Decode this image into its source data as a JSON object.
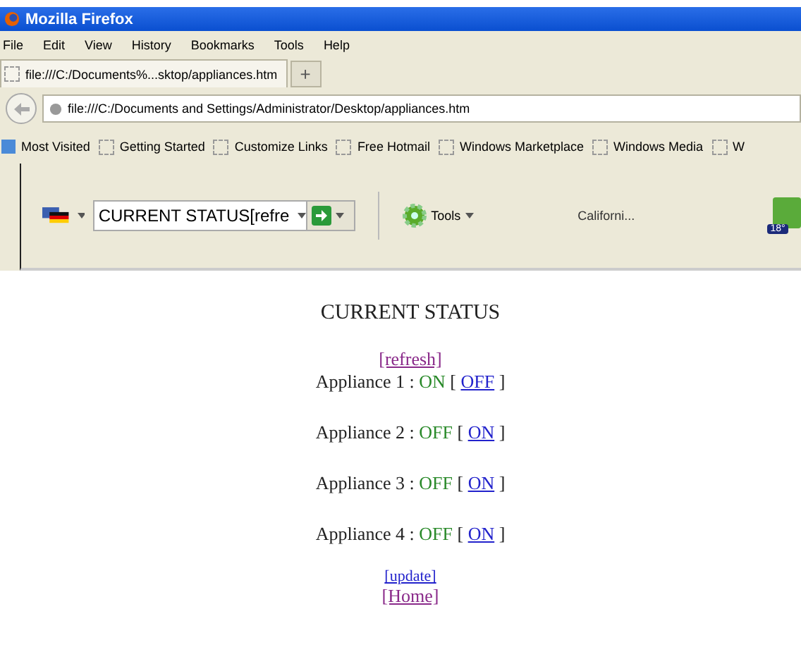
{
  "window": {
    "title": "Mozilla Firefox"
  },
  "menu": [
    "File",
    "Edit",
    "View",
    "History",
    "Bookmarks",
    "Tools",
    "Help"
  ],
  "tabs": [
    {
      "label": "file:///C:/Documents%...sktop/appliances.htm",
      "selected": true
    }
  ],
  "new_tab": "+",
  "address": {
    "value": "file:///C:/Documents and Settings/Administrator/Desktop/appliances.htm"
  },
  "bookmarks": [
    "Most Visited",
    "Getting Started",
    "Customize Links",
    "Free Hotmail",
    "Windows Marketplace",
    "Windows Media",
    "W"
  ],
  "toolbar": {
    "search_value": "CURRENT STATUS[refre",
    "tools": "Tools",
    "location": "Californi...",
    "temperature": "18°"
  },
  "page": {
    "heading": "CURRENT STATUS",
    "top_link": {
      "label": "[refresh]",
      "visited": true
    },
    "appliances": [
      {
        "name": "Appliance 1",
        "separator": ":",
        "status": "ON",
        "open": "[",
        "action": "OFF",
        "close": "]"
      },
      {
        "name": "Appliance 2",
        "separator": ":",
        "status": "OFF",
        "open": "[",
        "action": "ON",
        "close": "]"
      },
      {
        "name": "Appliance 3",
        "separator": ":",
        "status": "OFF",
        "open": "[",
        "action": "ON",
        "close": "]"
      },
      {
        "name": "Appliance 4",
        "separator": ":",
        "status": "OFF",
        "open": "[",
        "action": "ON",
        "close": "]"
      }
    ],
    "bottom_links": [
      {
        "label": "[update]",
        "visited": false
      },
      {
        "label": "[Home]",
        "visited": true
      }
    ]
  }
}
